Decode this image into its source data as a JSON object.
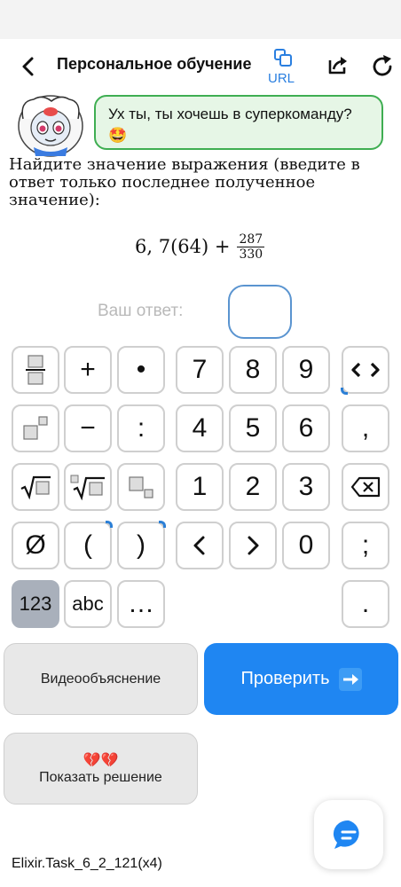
{
  "header": {
    "title": "Персональное обучение",
    "url_label": "URL",
    "icons": [
      "back-arrow-icon",
      "copy-link-icon",
      "share-icon",
      "refresh-icon"
    ]
  },
  "speech": {
    "text": "Ух ты, ты хочешь в суперкоманду? 🤩"
  },
  "task": {
    "instruction": "Найдите значение выражения (введите в ответ только последнее полученное значение):",
    "formula": {
      "main": "6, 7(64) +",
      "numerator": "287",
      "denominator": "330"
    }
  },
  "answer": {
    "label": "Ваш ответ:",
    "value": ""
  },
  "keypad": {
    "row1": [
      "fraction",
      "+",
      "•",
      "7",
      "8",
      "9",
      "<>"
    ],
    "row2": [
      "power",
      "−",
      ":",
      "4",
      "5",
      "6",
      ","
    ],
    "row3": [
      "sqrt",
      "nth-root",
      "subscript",
      "1",
      "2",
      "3",
      "backspace"
    ],
    "row4": [
      "Ø",
      "(",
      ")",
      "<",
      ">",
      "0",
      ";"
    ],
    "row5": [
      "123",
      "abc",
      "…",
      "."
    ]
  },
  "buttons": {
    "video": "Видеообъяснение",
    "check": "Проверить",
    "solution_emoji": "💔💔",
    "solution": "Показать решение"
  },
  "footer": {
    "task_id": "Elixir.Task_6_2_121(x4)"
  },
  "colors": {
    "accent_blue": "#1f86f2",
    "speech_border": "#3fae52",
    "speech_bg": "#e6f6e6",
    "input_border": "#5a94d0",
    "key_border": "#cfcfcf",
    "key_dark": "#a9b0bb"
  }
}
